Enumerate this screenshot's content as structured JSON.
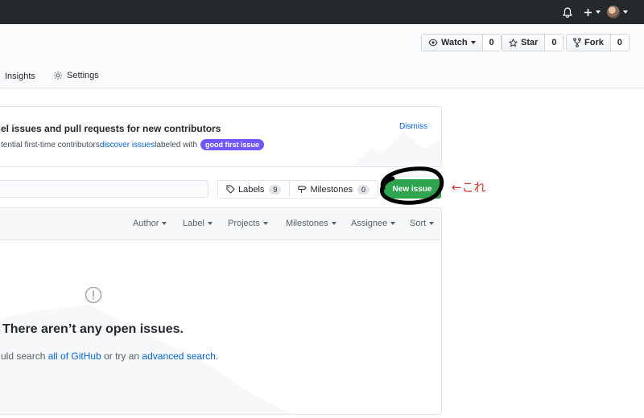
{
  "topbar": {
    "icons": [
      "bell-icon",
      "plus-icon",
      "avatar"
    ]
  },
  "repo_actions": {
    "watch": {
      "label": "Watch",
      "count": "0"
    },
    "star": {
      "label": "Star",
      "count": "0"
    },
    "fork": {
      "label": "Fork",
      "count": "0"
    }
  },
  "tabs": {
    "insights": "Insights",
    "settings": "Settings"
  },
  "contributors_panel": {
    "title": "el issues and pull requests for new contributors",
    "desc_prefix": "tential first-time contributors ",
    "desc_link": "discover issues",
    "desc_suffix": " labeled with",
    "badge": "good first issue",
    "dismiss": "Dismiss",
    "badge_color": "#7057ff"
  },
  "toolbar": {
    "labels": {
      "label": "Labels",
      "count": "9"
    },
    "milestones": {
      "label": "Milestones",
      "count": "0"
    },
    "new_issue": "New issue",
    "new_issue_color": "#2ea44f"
  },
  "annotation": {
    "text": "←これ",
    "color": "#d73a2c"
  },
  "filters": [
    "Author",
    "Label",
    "Projects",
    "Milestones",
    "Assignee",
    "Sort"
  ],
  "empty_state": {
    "title": "There aren’t any open issues.",
    "desc_prefix": "uld search ",
    "link1": "all of GitHub",
    "desc_middle": " or try an ",
    "link2": "advanced search",
    "desc_suffix": "."
  }
}
